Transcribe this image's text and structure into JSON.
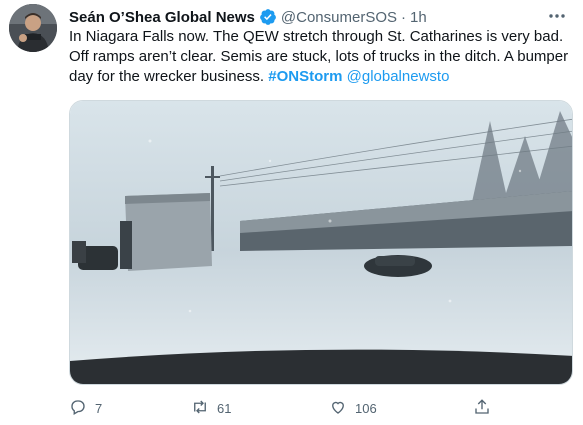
{
  "tweet": {
    "author_name": "Seán O’Shea Global News",
    "handle": "@ConsumerSOS",
    "separator": "·",
    "time": "1h",
    "text_part1": "In Niagara Falls now. The QEW stretch through St. Catharines is very bad. Off ramps aren’t clear. Semis are stuck, lots of trucks in the ditch. A bumper day for the wrecker business. ",
    "hashtag": "#ONStorm",
    "mention": "@globalnewsto"
  },
  "actions": {
    "replies": "7",
    "retweets": "61",
    "likes": "106"
  },
  "colors": {
    "link": "#1d9bf0",
    "verified": "#1d9bf0",
    "muted": "#536471"
  },
  "icons": [
    "verified-badge-icon",
    "more-icon",
    "reply-icon",
    "retweet-icon",
    "like-icon",
    "share-icon"
  ]
}
